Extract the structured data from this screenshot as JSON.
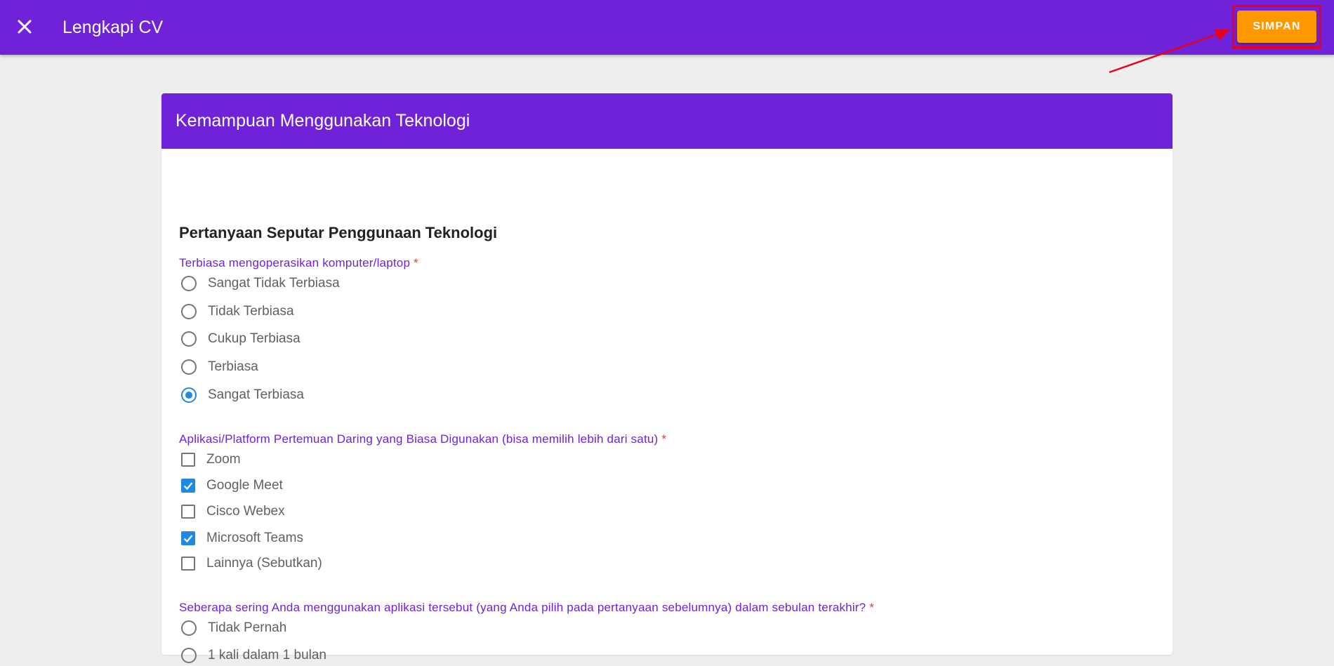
{
  "header": {
    "title": "Lengkapi CV",
    "save_label": "SIMPAN",
    "close_icon": "close-icon"
  },
  "card": {
    "title": "Kemampuan Menggunakan Teknologi",
    "section_title": "Pertanyaan Seputar Penggunaan Teknologi"
  },
  "questions": [
    {
      "label": "Terbiasa mengoperasikan komputer/laptop",
      "required_mark": "*",
      "type": "radio",
      "options": [
        {
          "label": "Sangat Tidak Terbiasa",
          "checked": false
        },
        {
          "label": "Tidak Terbiasa",
          "checked": false
        },
        {
          "label": "Cukup Terbiasa",
          "checked": false
        },
        {
          "label": "Terbiasa",
          "checked": false
        },
        {
          "label": "Sangat Terbiasa",
          "checked": true
        }
      ]
    },
    {
      "label": "Aplikasi/Platform Pertemuan Daring yang Biasa Digunakan (bisa memilih lebih dari satu)",
      "required_mark": "*",
      "type": "checkbox",
      "options": [
        {
          "label": "Zoom",
          "checked": false
        },
        {
          "label": "Google Meet",
          "checked": true
        },
        {
          "label": "Cisco Webex",
          "checked": false
        },
        {
          "label": "Microsoft Teams",
          "checked": true
        },
        {
          "label": "Lainnya (Sebutkan)",
          "checked": false
        }
      ]
    },
    {
      "label": "Seberapa sering Anda menggunakan aplikasi tersebut (yang Anda pilih pada pertanyaan sebelumnya) dalam sebulan terakhir?",
      "required_mark": "*",
      "type": "radio",
      "options": [
        {
          "label": "Tidak Pernah",
          "checked": false
        },
        {
          "label": "1 kali dalam 1 bulan",
          "checked": false
        }
      ]
    }
  ],
  "colors": {
    "primary": "#6f22d8",
    "accent": "#ff9800",
    "control_checked": "#1e88e5",
    "required": "#e53935",
    "annotation": "#e8001b"
  }
}
